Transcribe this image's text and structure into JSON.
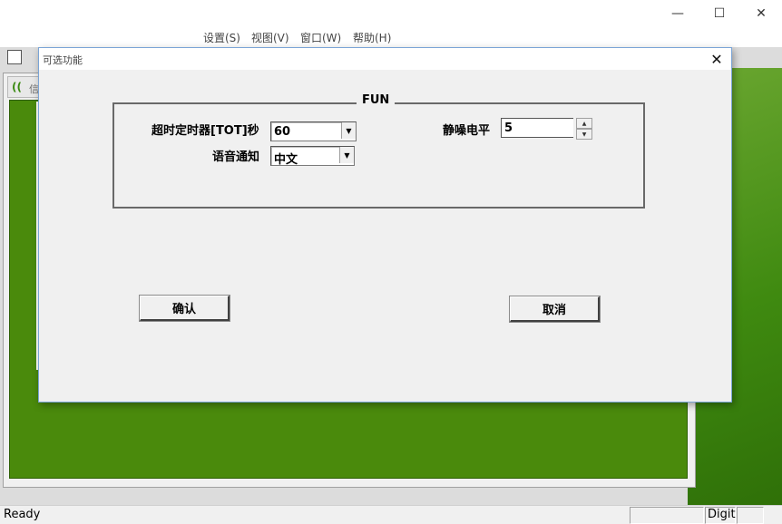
{
  "window": {
    "caption": {
      "minimize_icon": "minimize-icon",
      "maximize_icon": "maximize-icon",
      "close_icon": "close-icon"
    },
    "menu": [
      "设置(S)",
      "视图(V)",
      "窗口(W)",
      "帮助(H)"
    ]
  },
  "background": {
    "accent_color": "#4a8a0c"
  },
  "status": {
    "ready": "Ready",
    "panel_digit": "Digit"
  },
  "dialog": {
    "title": "可选功能",
    "close_icon": "close-icon",
    "group_title": "FUN",
    "tot_label": "超时定时器[TOT]秒",
    "tot_value": "60",
    "squelch_label": "静噪电平",
    "squelch_value": "5",
    "voice_label": "语音通知",
    "voice_value": "中文",
    "ok_label": "确认",
    "cancel_label": "取消"
  }
}
